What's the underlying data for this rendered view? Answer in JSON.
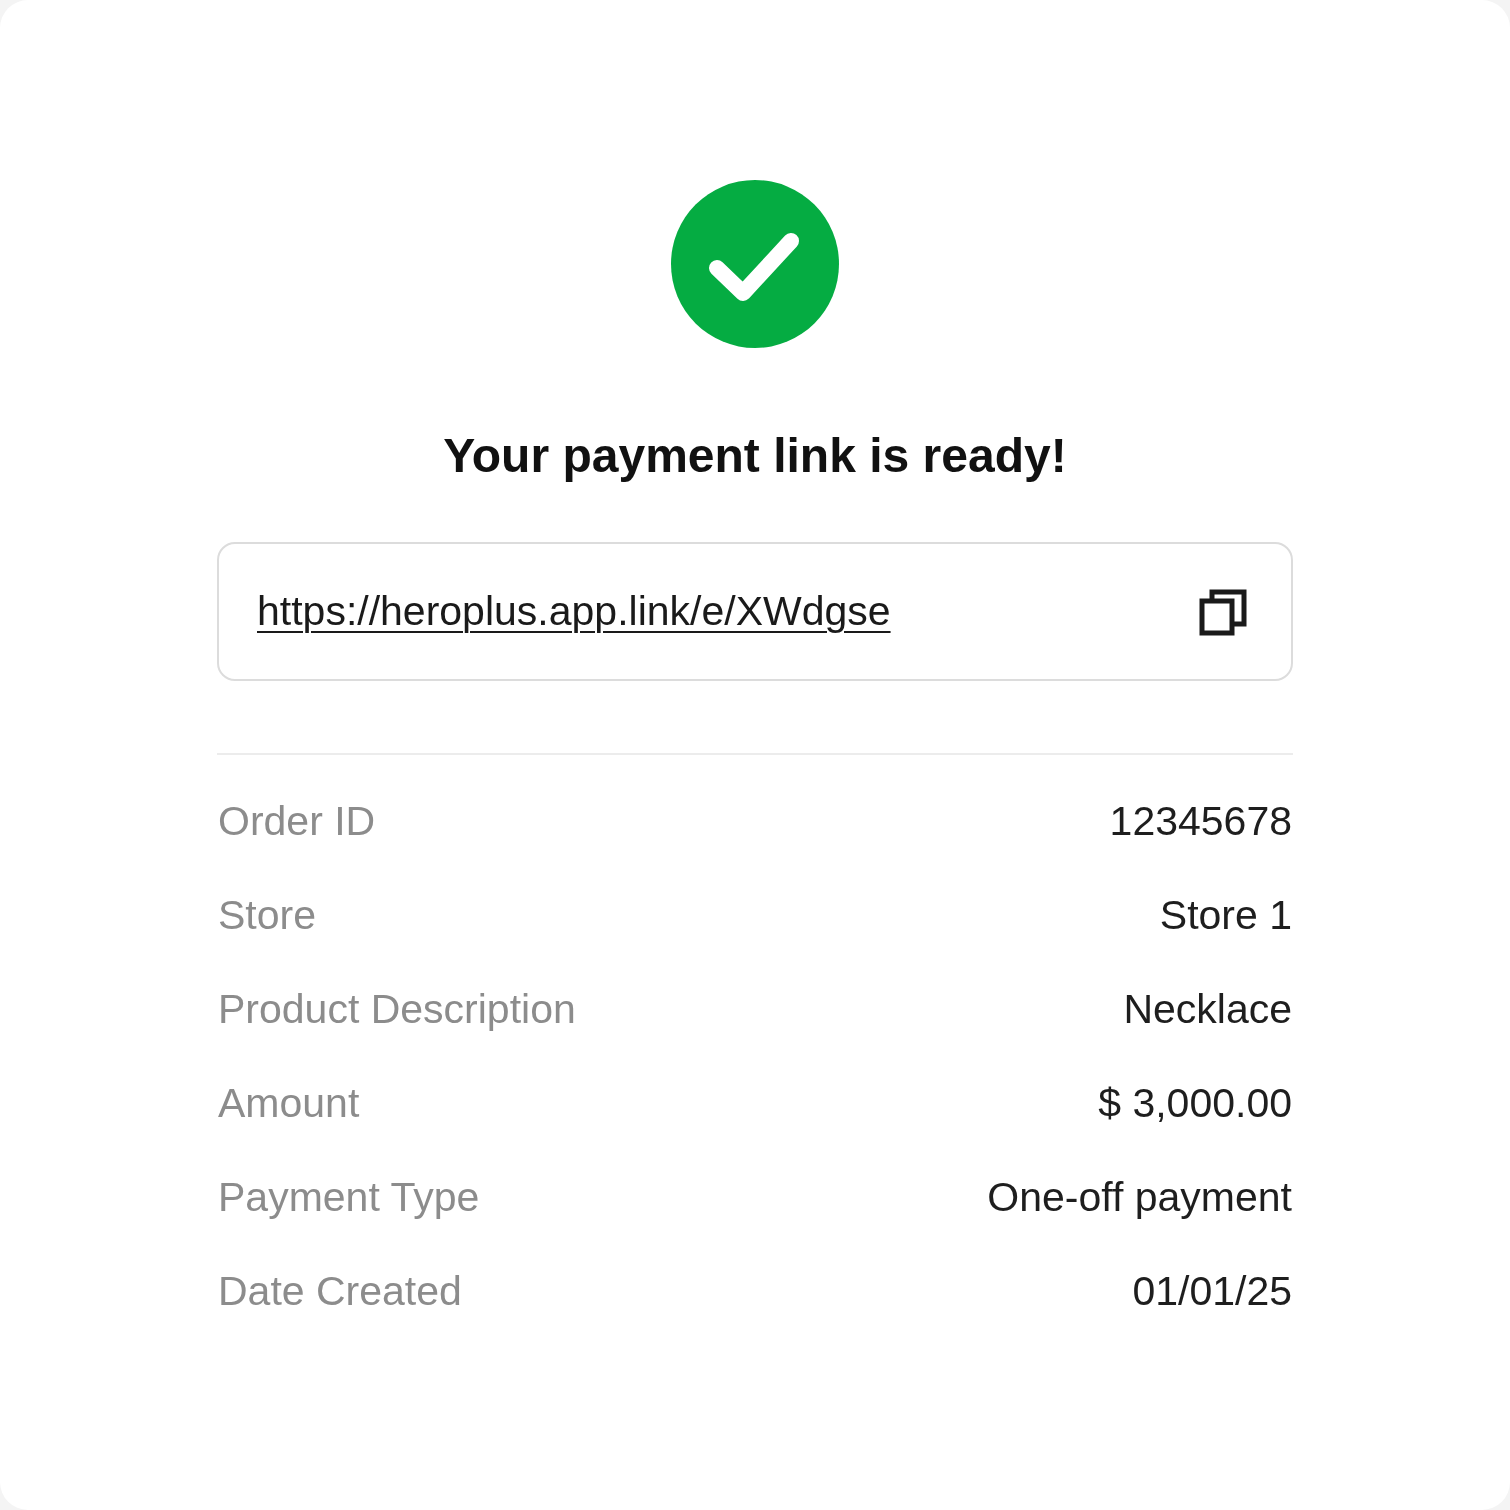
{
  "title": "Your payment link is ready!",
  "link": {
    "url": "https://heroplus.app.link/e/XWdgse"
  },
  "details": [
    {
      "label": "Order ID",
      "value": "12345678"
    },
    {
      "label": "Store",
      "value": "Store 1"
    },
    {
      "label": "Product Description",
      "value": "Necklace"
    },
    {
      "label": "Amount",
      "value": "$ 3,000.00"
    },
    {
      "label": "Payment Type",
      "value": "One-off payment"
    },
    {
      "label": "Date Created",
      "value": "01/01/25"
    }
  ]
}
